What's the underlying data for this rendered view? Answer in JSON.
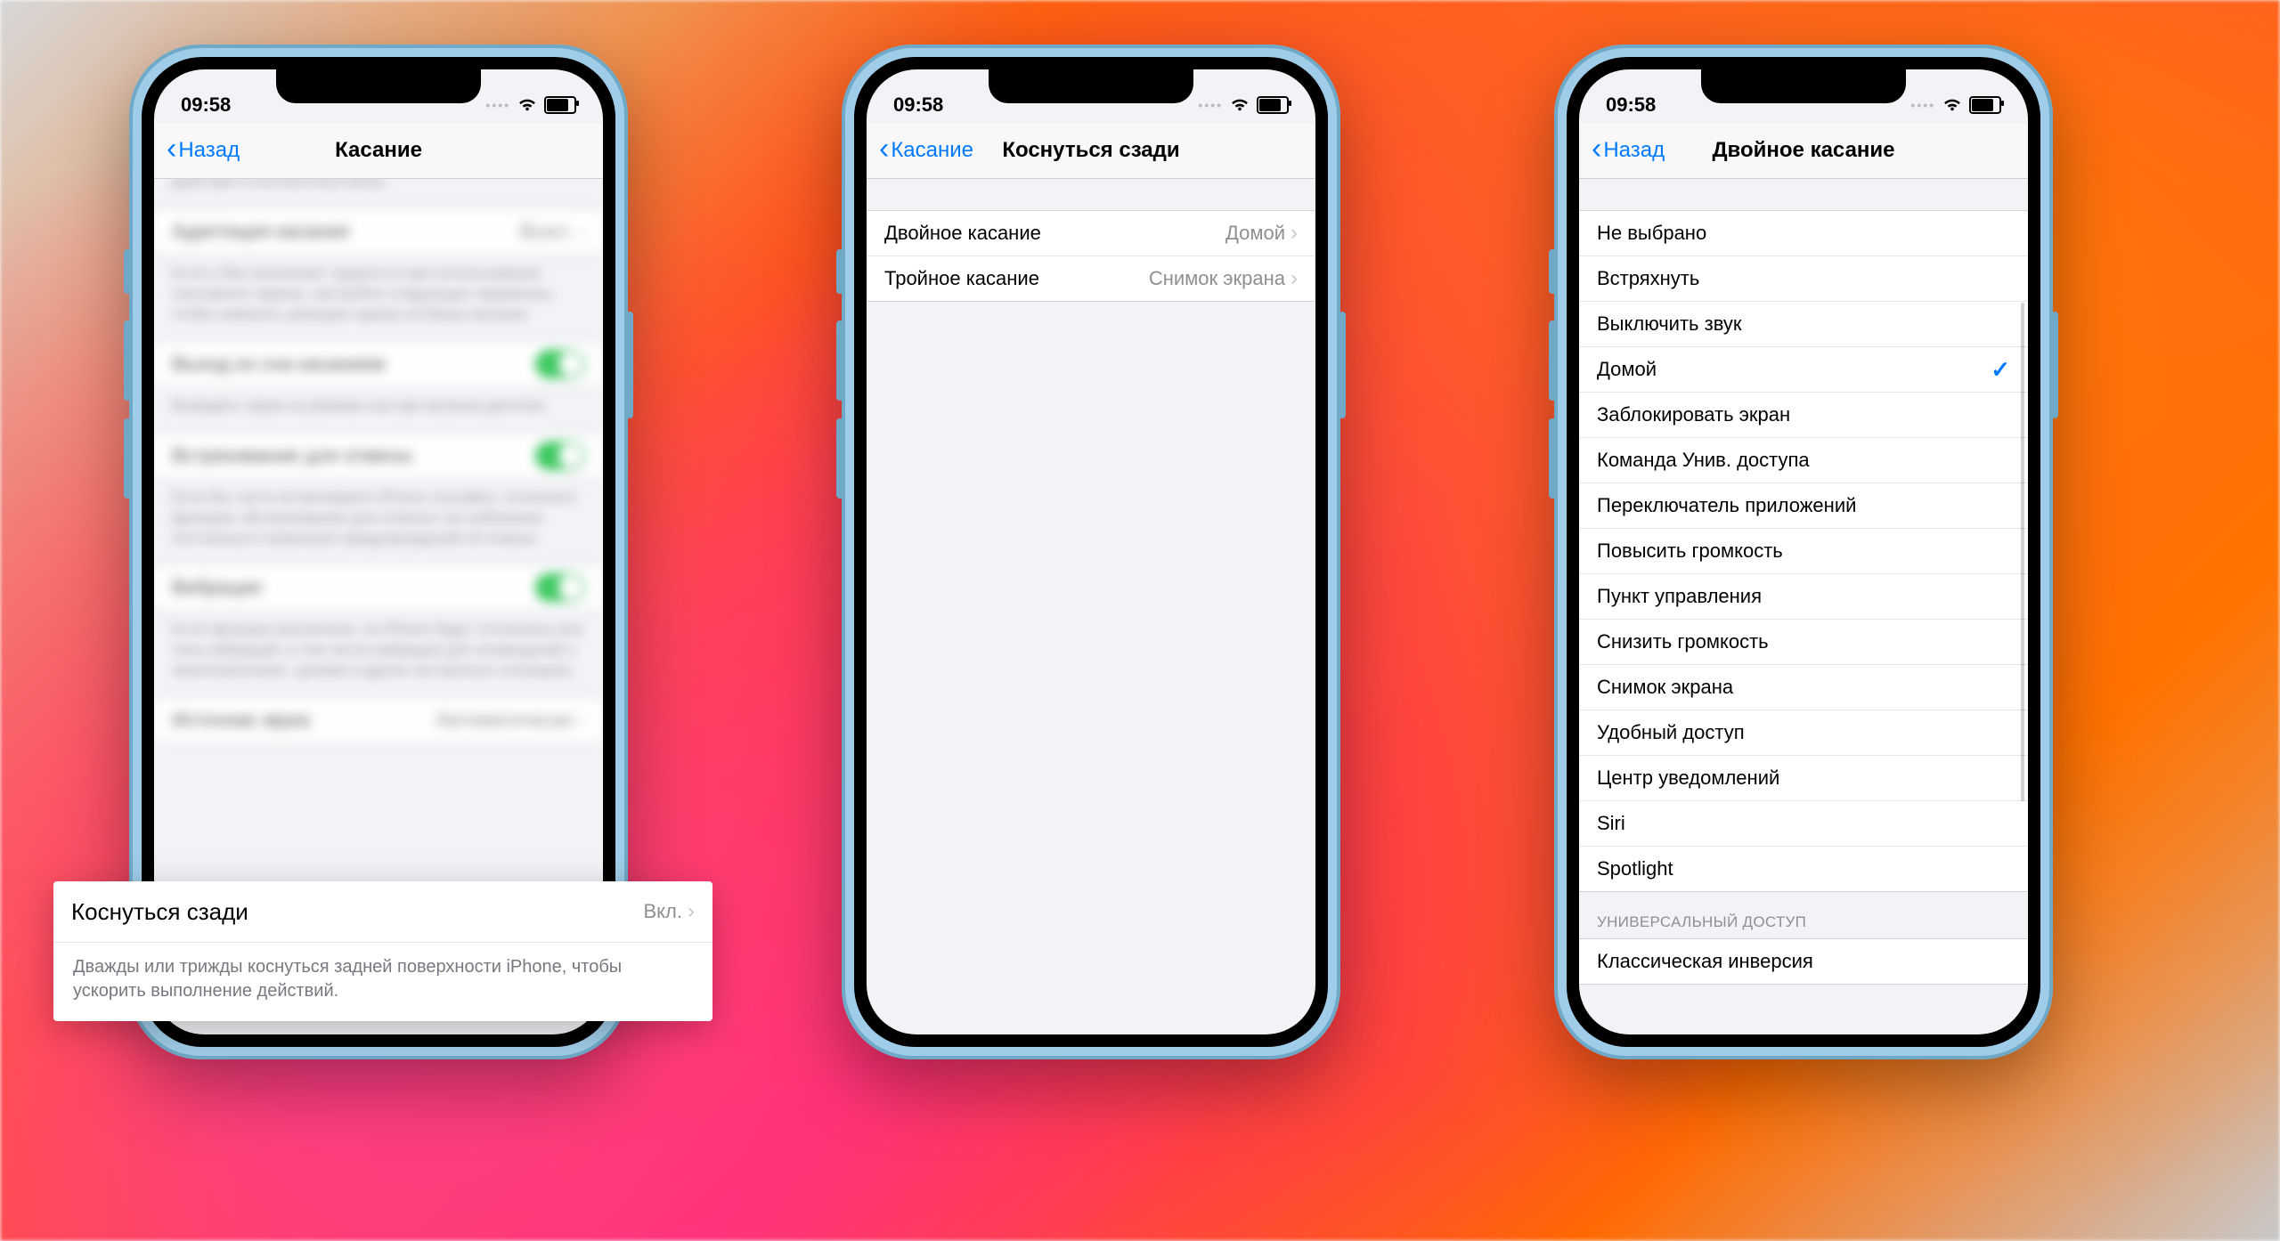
{
  "status": {
    "time": "09:58"
  },
  "phone1": {
    "nav": {
      "back": "Назад",
      "title": "Касание"
    },
    "blurred": {
      "topNote": "чтобы отображать предварительный просмотр, доступные действия и контекстные меню.",
      "row1": {
        "label": "Адаптация касания",
        "value": "Выкл."
      },
      "note1": "Если у Вас возникают трудности при использовании сенсорного экрана, настройте следующие параметры, чтобы изменить реакцию экрана на Ваши касания.",
      "row2": {
        "label": "Выход из сна касанием"
      },
      "note2": "Выводить экран из режима сна при касании дисплея.",
      "row3": {
        "label": "Встряхивание для отмены"
      },
      "note3": "Если Вы часто встряхиваете iPhone случайно, отключите функцию «Встряхивание для отмены» во избежание постоянного появления предупреждений об отмене.",
      "row4": {
        "label": "Вибрация"
      },
      "note4": "Если функция выключена, на iPhone будут отключены все типы вибраций, в том числе вибрации для оповещений о землетрясениях, цунами и других экстренных ситуациях.",
      "row5": {
        "label": "Источник звука",
        "value": "Автоматически"
      }
    },
    "callout": {
      "label": "Коснуться сзади",
      "value": "Вкл.",
      "note": "Дважды или трижды коснуться задней поверхности iPhone, чтобы ускорить выполнение действий."
    }
  },
  "phone2": {
    "nav": {
      "back": "Касание",
      "title": "Коснуться сзади"
    },
    "rows": [
      {
        "label": "Двойное касание",
        "value": "Домой"
      },
      {
        "label": "Тройное касание",
        "value": "Снимок экрана"
      }
    ]
  },
  "phone3": {
    "nav": {
      "back": "Назад",
      "title": "Двойное касание"
    },
    "options": [
      {
        "label": "Не выбрано",
        "selected": false
      },
      {
        "label": "Встряхнуть",
        "selected": false
      },
      {
        "label": "Выключить звук",
        "selected": false
      },
      {
        "label": "Домой",
        "selected": true
      },
      {
        "label": "Заблокировать экран",
        "selected": false
      },
      {
        "label": "Команда Унив. доступа",
        "selected": false
      },
      {
        "label": "Переключатель приложений",
        "selected": false
      },
      {
        "label": "Повысить громкость",
        "selected": false
      },
      {
        "label": "Пункт управления",
        "selected": false
      },
      {
        "label": "Снизить громкость",
        "selected": false
      },
      {
        "label": "Снимок экрана",
        "selected": false
      },
      {
        "label": "Удобный доступ",
        "selected": false
      },
      {
        "label": "Центр уведомлений",
        "selected": false
      },
      {
        "label": "Siri",
        "selected": false
      },
      {
        "label": "Spotlight",
        "selected": false
      }
    ],
    "sectionHeader": "УНИВЕРСАЛЬНЫЙ ДОСТУП",
    "section2": [
      {
        "label": "Классическая инверсия",
        "selected": false
      }
    ]
  }
}
